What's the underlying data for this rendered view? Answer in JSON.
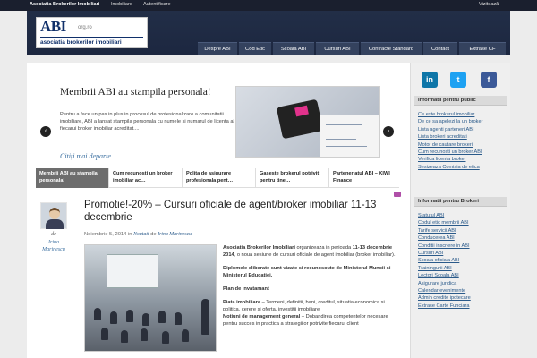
{
  "topbar": {
    "site": "Asociatia Brokerilor Imobiliari",
    "links": [
      "Imobiliare",
      "Autentificare"
    ],
    "visitor": "Vizitează"
  },
  "logo": {
    "main": "ABI",
    "domain": "org.ro",
    "tagline": "asociatia brokerilor imobiliari"
  },
  "nav": [
    "Despre ABI",
    "Cod Etic",
    "Scoala ABI",
    "Cursuri ABI",
    "Contracte Standard",
    "Contact",
    "Extrase CF"
  ],
  "slider": {
    "title": "Membrii ABI au stampila personala!",
    "text": "Pentru a face un pas in plus in procesul de profesionalizare a comunitatii imobiliare, ABI a lansat stampila personala cu numele si numarul de licenta al fiecarui broker imobiliar acreditat....",
    "more": "Citiți mai departe",
    "prev": "‹",
    "next": "›"
  },
  "tabs": [
    "Membrii ABI au stampila personala!",
    "Cum recunoști un broker imobiliar ac…",
    "Polita de asigurare profesionala pent…",
    "Gaseste brokerul potrivit pentru tine…",
    "Parteneriatul ABI – KIWI Finance"
  ],
  "post": {
    "title": "Promotie!-20% – Cursuri oficiale de agent/broker imobiliar 11-13 decembrie",
    "date": "Noiembrie 5, 2014",
    "in": "in",
    "category": "Noutati",
    "by": "de",
    "author": "Irina Marinescu",
    "author_de": "de",
    "p1_strong": "Asociatia Brokerilor Imobiliari",
    "p1_mid": " organizeaza in perioada ",
    "p1_date": "11-13 decembrie 2014",
    "p1_end": ", o noua sesiune de cursuri oficiale de agent imobiliar (broker imobiliar).",
    "p2": "Diplomele eliberate sunt vizate si recunoscute de Ministerul Muncii si Ministerul Educatiei.",
    "p3": "Plan de invatamant",
    "p4_strong": "Piata imobiliara",
    "p4_rest": " – Termeni, definitii, bani, creditul, situatia economica si politica, cerere si oferta, investitii imobiliare",
    "p5_strong": "Notiuni de management general",
    "p5_rest": " – Dobandirea competentelor necesare pentru succes in practica a strategiilor potrivite fiecarui client"
  },
  "sidebar": {
    "social": [
      {
        "name": "LinkedIn",
        "glyph": "in",
        "color": "#0e76a8"
      },
      {
        "name": "Twitter",
        "glyph": "t",
        "color": "#1da1f2"
      },
      {
        "name": "Facebook",
        "glyph": "f",
        "color": "#3b5998"
      }
    ],
    "public_title": "Informatii pentru public",
    "public_links": [
      "Ce este brokerul imobiliar",
      "De ce sa apelezi la un broker",
      "Lista agenti parteneri ABI",
      "Lista brokeri acreditati",
      "Motor de cautare brokeri",
      "Cum recunosti un broker ABI",
      "Verifica licenta broker",
      "Sesizeaza Comisia de etica"
    ],
    "brokers_title": "Informatii pentru Brokeri",
    "broker_links": [
      "Statutul ABI",
      "Codul etic membrii ABI",
      "Tarife servicii ABI",
      "Conducerea ABI",
      "Conditii inscriere in ABI",
      "Cursuri ABI",
      "Scoala oficiala ABI",
      "Trainingurii ABI",
      "Lectori Scoala ABI",
      "Asigurare juridica",
      "Calendar evenimente",
      "Admin credite ipotecare",
      "Extrase Carte Funciara"
    ]
  }
}
